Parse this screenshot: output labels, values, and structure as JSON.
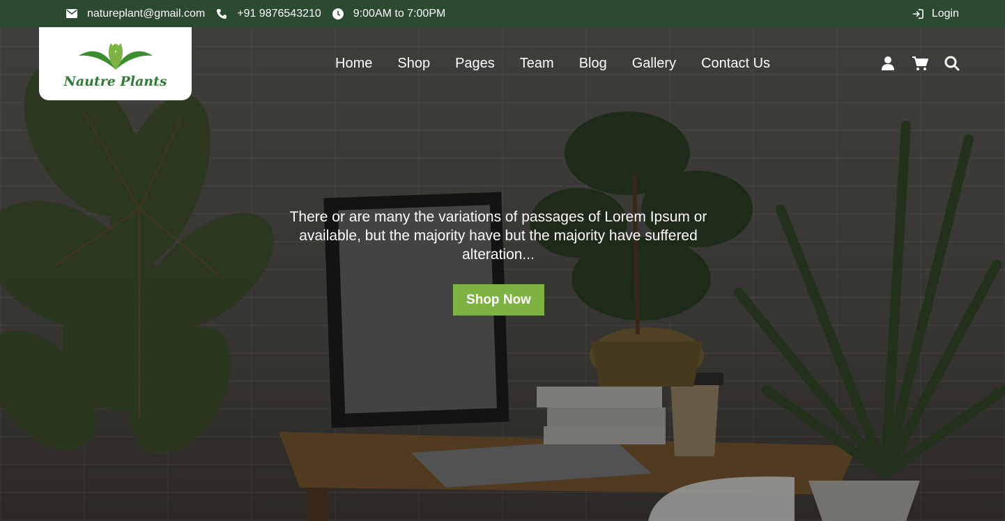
{
  "topbar": {
    "email": "natureplant@gmail.com",
    "phone": "+91 9876543210",
    "hours": "9:00AM to 7:00PM",
    "login": "Login",
    "icons": [
      "envelope-icon",
      "phone-icon",
      "clock-icon",
      "login-icon"
    ]
  },
  "logo": {
    "text": "Nautre Plants"
  },
  "nav": {
    "items": [
      "Home",
      "Shop",
      "Pages",
      "Team",
      "Blog",
      "Gallery",
      "Contact Us"
    ],
    "icons": [
      "user-icon",
      "cart-icon",
      "search-icon"
    ]
  },
  "hero": {
    "text": "There or are many the variations of passages of Lorem Ipsum or available, but the majority have but the majority have suffered alteration...",
    "button": "Shop Now"
  },
  "colors": {
    "topbar": "#2b4a30",
    "accent": "#7cb342",
    "logo": "#2f7a36"
  }
}
